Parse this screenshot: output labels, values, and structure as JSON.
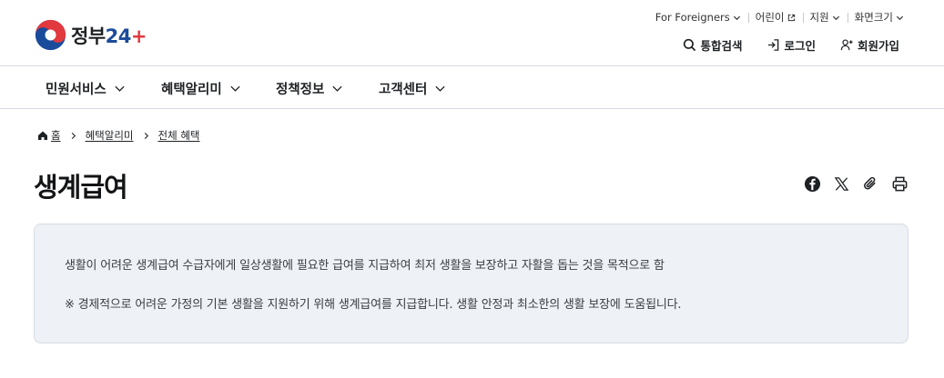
{
  "logo": {
    "text_main": "정부",
    "text_num": "2",
    "text_num2": "4",
    "text_plus": "+"
  },
  "utility": {
    "foreigners": "For Foreigners",
    "kids": "어린이",
    "region": "지원",
    "font_size": "화면크기"
  },
  "actions": {
    "search": "통합검색",
    "login": "로그인",
    "signup": "회원가입"
  },
  "nav": [
    {
      "label": "민원서비스"
    },
    {
      "label": "혜택알리미"
    },
    {
      "label": "정책정보"
    },
    {
      "label": "고객센터"
    }
  ],
  "breadcrumb": {
    "home": "홈",
    "level1": "혜택알리미",
    "level2": "전체 혜택"
  },
  "page": {
    "title": "생계급여",
    "share_icons": [
      "facebook-icon",
      "x-icon",
      "link-icon",
      "print-icon"
    ]
  },
  "info": {
    "line1": "생활이 어려운 생계급여 수급자에게 일상생활에 필요한 급여를 지급하여 최저 생활을 보장하고 자활을 돕는 것을 목적으로 함",
    "line2": "※ 경제적으로 어려운 가정의 기본 생활을 지원하기 위해 생계급여를 지급합니다. 생활 안정과 최소한의 생활 보장에 도움됩니다."
  },
  "colors": {
    "brand_blue": "#1b4b9b",
    "brand_red": "#e2393e",
    "info_bg": "#eef1f6",
    "border": "#d6d9dd"
  }
}
